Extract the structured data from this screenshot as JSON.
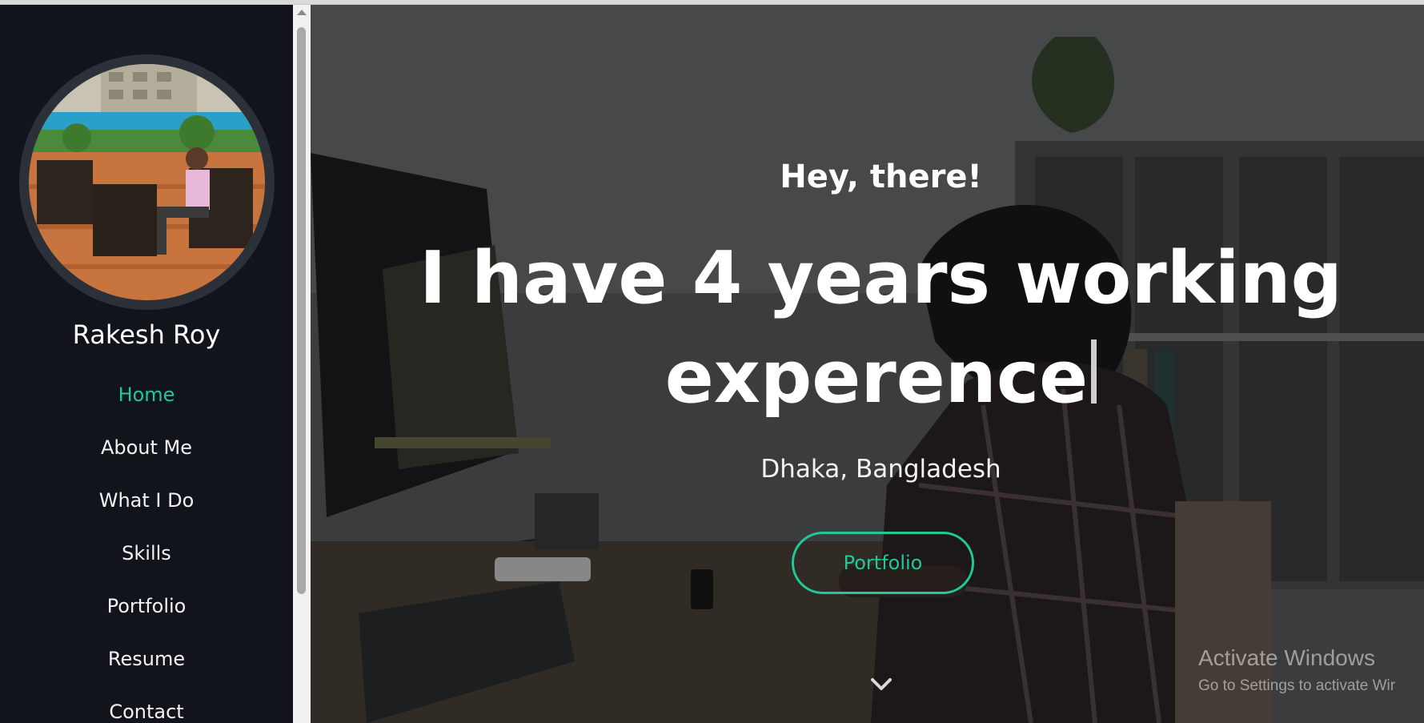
{
  "sidebar": {
    "name": "Rakesh Roy",
    "avatar_icon": "profile-photo",
    "nav": [
      {
        "label": "Home",
        "active": true
      },
      {
        "label": "About Me",
        "active": false
      },
      {
        "label": "What I Do",
        "active": false
      },
      {
        "label": "Skills",
        "active": false
      },
      {
        "label": "Portfolio",
        "active": false
      },
      {
        "label": "Resume",
        "active": false
      },
      {
        "label": "Contact",
        "active": false
      }
    ]
  },
  "hero": {
    "greeting": "Hey, there!",
    "headline": "I have 4 years working experence",
    "location": "Dhaka, Bangladesh",
    "button_label": "Portfolio",
    "scroll_icon": "chevron-down-icon"
  },
  "watermark": {
    "title": "Activate Windows",
    "subtitle": "Go to Settings to activate Wir"
  },
  "colors": {
    "accent": "#20c997",
    "sidebar_bg": "#11141a",
    "avatar_ring": "#2c3038"
  }
}
